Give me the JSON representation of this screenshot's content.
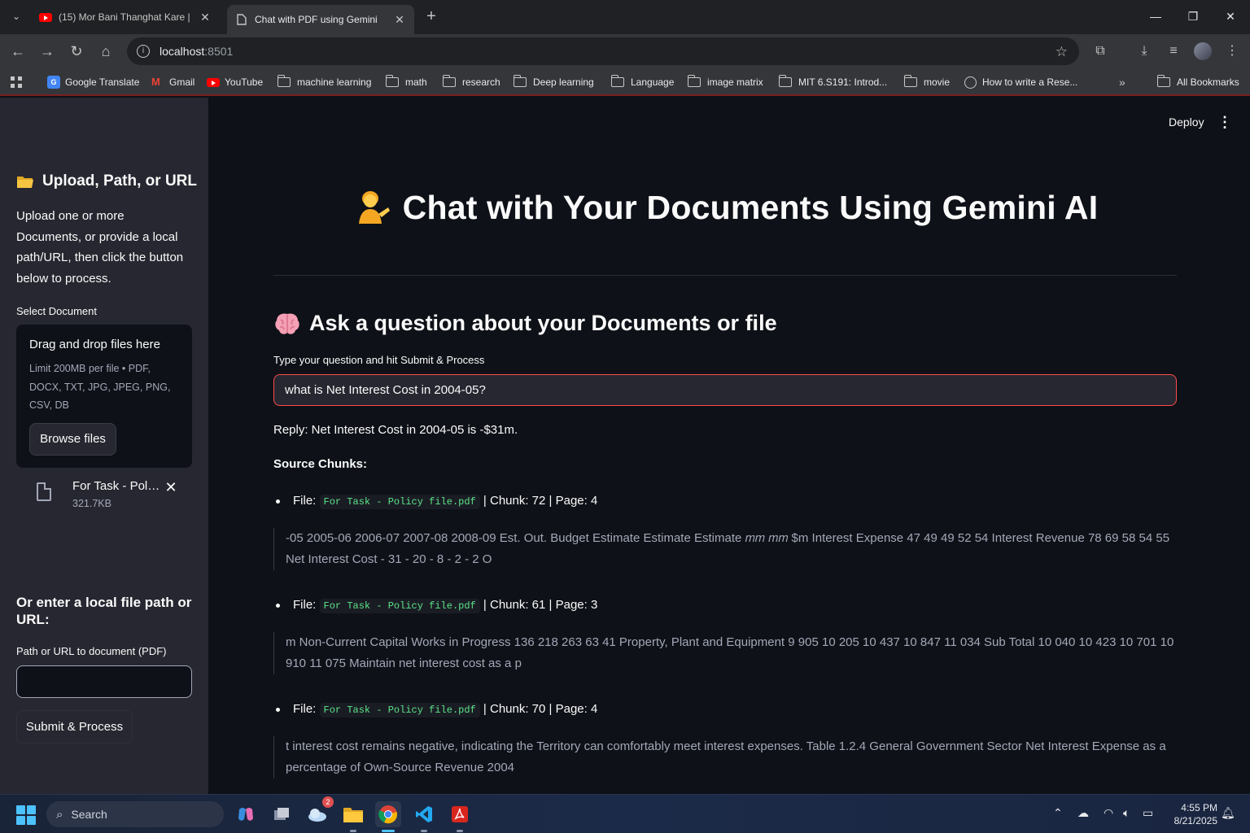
{
  "browser": {
    "tabs": [
      {
        "title": "(15) Mor Bani Thanghat Kare | M",
        "icon": "youtube-icon",
        "active": false
      },
      {
        "title": "Chat with PDF using Gemini",
        "icon": "document-icon",
        "active": true
      }
    ],
    "url_host": "localhost",
    "url_port": ":8501",
    "bookmarks": [
      {
        "label": "Google Translate",
        "icon": "google-translate-icon"
      },
      {
        "label": "Gmail",
        "icon": "gmail-icon"
      },
      {
        "label": "YouTube",
        "icon": "youtube-icon"
      },
      {
        "label": "machine learning",
        "icon": "folder-icon"
      },
      {
        "label": "math",
        "icon": "folder-icon"
      },
      {
        "label": "research",
        "icon": "folder-icon"
      },
      {
        "label": "Deep learning",
        "icon": "folder-icon"
      },
      {
        "label": "Language",
        "icon": "folder-icon"
      },
      {
        "label": "image matrix",
        "icon": "folder-icon"
      },
      {
        "label": "MIT 6.S191: Introd...",
        "icon": "folder-icon"
      },
      {
        "label": "movie",
        "icon": "folder-icon"
      },
      {
        "label": "How to write a Rese...",
        "icon": "globe-icon"
      }
    ],
    "all_bookmarks": "All Bookmarks"
  },
  "sidebar": {
    "header": "Upload, Path, or URL",
    "instructions": "Upload one or more Documents, or provide a local path/URL, then click the button below to process.",
    "select_label": "Select Document",
    "dropzone_title": "Drag and drop files here",
    "dropzone_limit": "Limit 200MB per file • PDF, DOCX, TXT, JPG, JPEG, PNG, CSV, DB",
    "browse_label": "Browse files",
    "file": {
      "name": "For Task - Policy file.pdf",
      "size": "321.7KB"
    },
    "path_header": "Or enter a local file path or URL:",
    "path_label": "Path or URL to document (PDF)",
    "path_value": "",
    "submit_label": "Submit & Process"
  },
  "main": {
    "deploy_label": "Deploy",
    "title": "Chat with Your Documents Using Gemini AI",
    "subheader": "Ask a question about your Documents or file",
    "question_label": "Type your question and hit Submit & Process",
    "question_value": "what is Net Interest Cost in 2004-05?",
    "reply": "Reply: Net Interest Cost in 2004-05 is -$31m.",
    "sources_header": "Source Chunks:",
    "chunks": [
      {
        "file_prefix": "File:",
        "file": "For Task - Policy file.pdf",
        "meta": "| Chunk: 72 | Page: 4",
        "text": "-05 2005-06 2006-07 2007-08 2008-09 Est. Out. Budget Estimate Estimate Estimate 𝑚𝑚 𝑚𝑚 $m Interest Expense 47 49 49 52 54 Interest Revenue 78 69 58 54 55 Net Interest Cost - 31 - 20 - 8 - 2 - 2 O"
      },
      {
        "file_prefix": "File:",
        "file": "For Task - Policy file.pdf",
        "meta": "| Chunk: 61 | Page: 3",
        "text": "m Non-Current Capital Works in Progress 136 218 263 63 41 Property, Plant and Equipment 9 905 10 205 10 437 10 847 11 034 Sub Total 10 040 10 423 10 701 10 910 11 075 Maintain net interest cost as a p"
      },
      {
        "file_prefix": "File:",
        "file": "For Task - Policy file.pdf",
        "meta": "| Chunk: 70 | Page: 4",
        "text": "t interest cost remains negative, indicating the Territory can comfortably meet interest expenses. Table 1.2.4 General Government Sector Net Interest Expense as a percentage of Own-Source Revenue 2004"
      }
    ]
  },
  "taskbar": {
    "search_placeholder": "Search",
    "weather_badge": "2",
    "time": "4:55 PM",
    "date": "8/21/2025"
  }
}
